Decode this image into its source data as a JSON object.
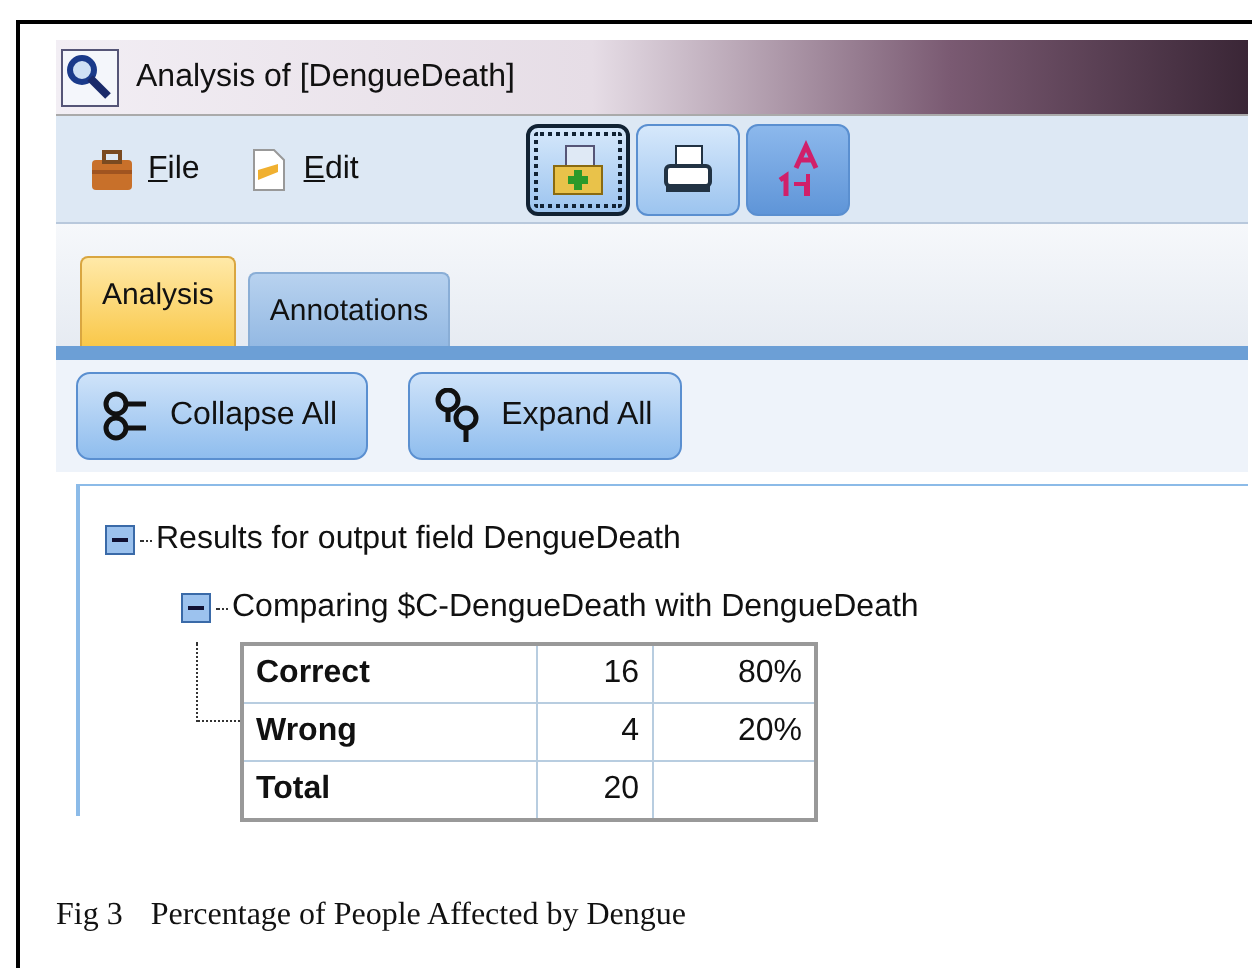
{
  "window": {
    "title": "Analysis of [DengueDeath]"
  },
  "menu": [
    {
      "label": "File"
    },
    {
      "label": "Edit"
    }
  ],
  "toolbar": [
    {
      "focused": true,
      "pressed": false
    },
    {
      "focused": false,
      "pressed": false
    },
    {
      "focused": false,
      "pressed": true
    }
  ],
  "tabs": [
    {
      "label": "Analysis",
      "selected": true
    },
    {
      "label": "Annotations",
      "selected": false
    }
  ],
  "actions": [
    {
      "label": "Collapse All"
    },
    {
      "label": "Expand All"
    }
  ],
  "tree": [
    {
      "label": "Results for output field DengueDeath",
      "expanded": true,
      "children": [
        {
          "label": "Comparing $C-DengueDeath with DengueDeath",
          "expanded": true,
          "table": [
            {
              "label": "Correct",
              "count": "16",
              "percent": "80%"
            },
            {
              "label": "Wrong",
              "count": "4",
              "percent": "20%"
            },
            {
              "label": "Total",
              "count": "20"
            }
          ]
        }
      ]
    }
  ],
  "caption": {
    "label": "Fig 3",
    "text": "Percentage of People Affected by Dengue"
  }
}
